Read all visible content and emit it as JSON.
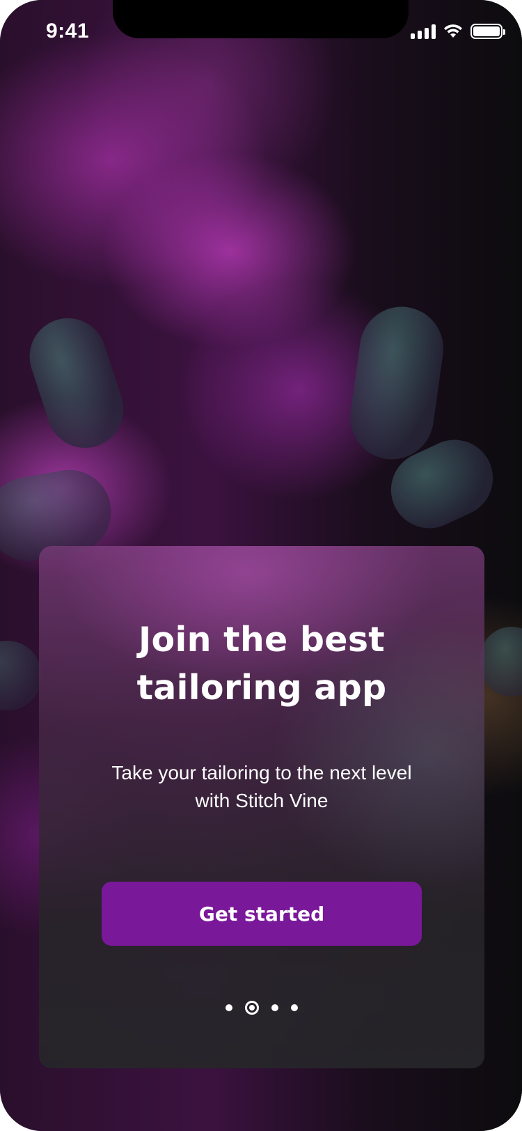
{
  "status_bar": {
    "time": "9:41",
    "icons": [
      "cellular-signal-icon",
      "wifi-icon",
      "battery-icon"
    ]
  },
  "background": {
    "description_icon": "purple-powder-hands-photo",
    "accent_color": "#7a189a"
  },
  "onboarding": {
    "title_line1": "Join the best",
    "title_line2": "tailoring app",
    "subtitle_line1": "Take your tailoring to the next level",
    "subtitle_line2": "with Stitch Vine",
    "cta_label": "Get started",
    "pagination": {
      "total": 4,
      "active_index": 1
    }
  },
  "colors": {
    "button_bg": "#7a189a",
    "text": "#ffffff"
  }
}
